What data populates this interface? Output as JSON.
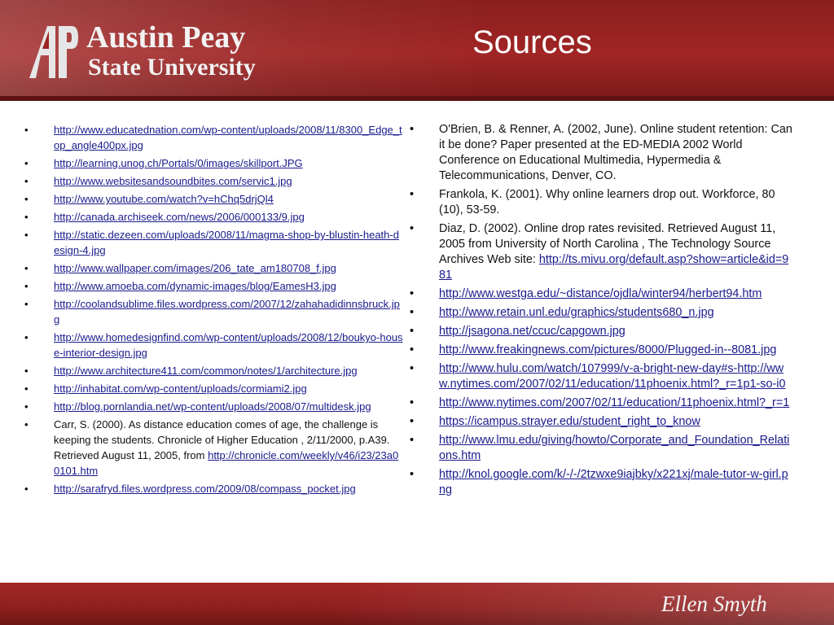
{
  "header": {
    "logo_line1": "Austin Peay",
    "logo_line2": "State University",
    "title": "Sources"
  },
  "left_column": [
    {
      "type": "link",
      "text": "http://www.educatednation.com/wp-content/uploads/2008/11/8300_Edge_top_angle400px.jpg"
    },
    {
      "type": "link",
      "text": "http://learning.unog.ch/Portals/0/images/skillport.JPG"
    },
    {
      "type": "link",
      "text": "http://www.websitesandsoundbites.com/servic1.jpg"
    },
    {
      "type": "link",
      "text": "http://www.youtube.com/watch?v=hChq5drjQl4"
    },
    {
      "type": "link",
      "text": "http://canada.archiseek.com/news/2006/000133/9.jpg"
    },
    {
      "type": "link",
      "text": "http://static.dezeen.com/uploads/2008/11/magma-shop-by-blustin-heath-design-4.jpg"
    },
    {
      "type": "link",
      "text": "http://www.wallpaper.com/images/206_tate_am180708_f.jpg"
    },
    {
      "type": "link",
      "text": "http://www.amoeba.com/dynamic-images/blog/EamesH3.jpg"
    },
    {
      "type": "link",
      "text": "http://coolandsublime.files.wordpress.com/2007/12/zahahadidinnsbruck.jpg"
    },
    {
      "type": "link",
      "text": "http://www.homedesignfind.com/wp-content/uploads/2008/12/boukyo-house-interior-design.jpg"
    },
    {
      "type": "link",
      "text": "http://www.architecture411.com/common/notes/1/architecture.jpg"
    },
    {
      "type": "link",
      "text": "http://inhabitat.com/wp-content/uploads/cormiami2.jpg"
    },
    {
      "type": "link",
      "text": "http://blog.pornlandia.net/wp-content/uploads/2008/07/multidesk.jpg"
    },
    {
      "type": "ref",
      "text": "Carr, S. (2000). As distance education comes of age, the challenge is keeping the students. Chronicle of Higher Education , 2/11/2000, p.A39. Retrieved August 11, 2005, from ",
      "link": "http://chronicle.com/weekly/v46/i23/23a00101.htm"
    },
    {
      "type": "link",
      "text": "http://sarafryd.files.wordpress.com/2009/08/compass_pocket.jpg"
    }
  ],
  "right_column": [
    {
      "type": "ref",
      "text": "O'Brien, B. & Renner, A. (2002, June). Online student retention: Can it be done? Paper presented at the ED-MEDIA 2002 World Conference on Educational Multimedia, Hypermedia & Telecommunications, Denver, CO."
    },
    {
      "type": "ref",
      "text": "Frankola, K. (2001). Why online learners drop out. Workforce, 80 (10), 53-59."
    },
    {
      "type": "ref",
      "text": "Diaz, D. (2002). Online drop rates revisited. Retrieved August 11, 2005 from University of North Carolina , The Technology Source Archives Web site: ",
      "link": "http://ts.mivu.org/default.asp?show=article&id=981"
    },
    {
      "type": "link",
      "text": "http://www.westga.edu/~distance/ojdla/winter94/herbert94.htm"
    },
    {
      "type": "link",
      "text": "http://www.retain.unl.edu/graphics/students680_n.jpg"
    },
    {
      "type": "link",
      "text": "http://jsagona.net/ccuc/capgown.jpg"
    },
    {
      "type": "link",
      "text": "http://www.freakingnews.com/pictures/8000/Plugged-in--8081.jpg"
    },
    {
      "type": "link",
      "text": "http://www.hulu.com/watch/107999/v-a-bright-new-day#s-http://www.nytimes.com/2007/02/11/education/11phoenix.html?_r=1p1-so-i0"
    },
    {
      "type": "link",
      "text": "http://www.nytimes.com/2007/02/11/education/11phoenix.html?_r=1"
    },
    {
      "type": "link",
      "text": "https://icampus.strayer.edu/student_right_to_know"
    },
    {
      "type": "link",
      "text": "http://www.lmu.edu/giving/howto/Corporate_and_Foundation_Relations.htm"
    },
    {
      "type": "link",
      "text": "http://knol.google.com/k/-/-/2tzwxe9iajbky/x221xj/male-tutor-w-girl.png"
    }
  ],
  "footer": {
    "signature": "Ellen Smyth"
  },
  "colors": {
    "brand_maroon": "#8a1e1e",
    "link_blue": "#1a1a8c"
  }
}
